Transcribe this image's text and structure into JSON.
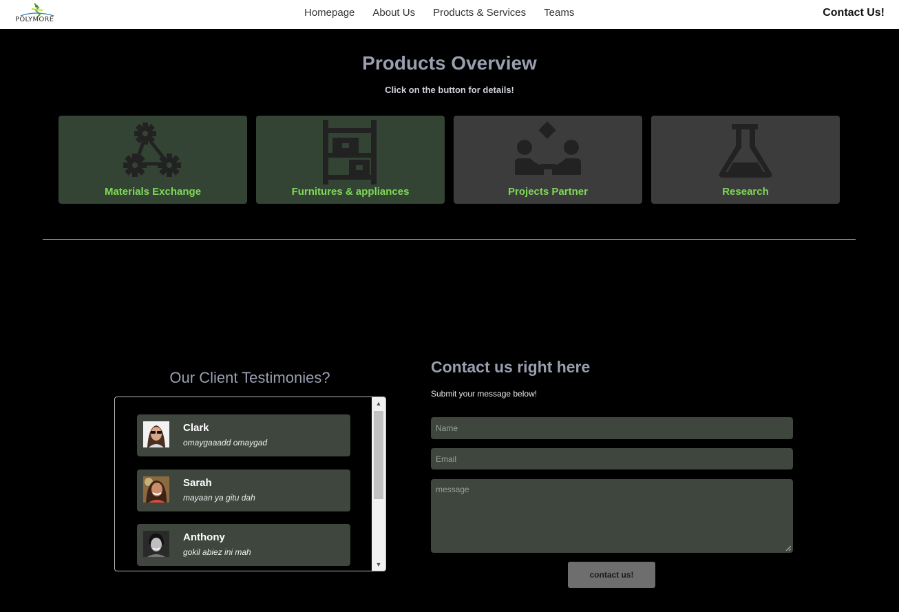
{
  "nav": {
    "logo_text": "POLYMORE",
    "links": [
      "Homepage",
      "About Us",
      "Products & Services",
      "Teams"
    ],
    "contact": "Contact Us!"
  },
  "products": {
    "title": "Products Overview",
    "subtitle": "Click on the button for details!",
    "cards": [
      {
        "label": "Materials Exchange",
        "icon": "gears-network-icon"
      },
      {
        "label": "Furnitures & appliances",
        "icon": "shelf-icon"
      },
      {
        "label": "Projects Partner",
        "icon": "handshake-icon"
      },
      {
        "label": "Research",
        "icon": "flask-icon"
      }
    ]
  },
  "testimonies": {
    "title": "Our Client Testimonies?",
    "items": [
      {
        "name": "Clark",
        "quote": "omaygaaadd omaygad"
      },
      {
        "name": "Sarah",
        "quote": "mayaan ya gitu dah"
      },
      {
        "name": "Anthony",
        "quote": "gokil abiez ini mah"
      }
    ]
  },
  "contact": {
    "title": "Contact us right here",
    "subtitle": "Submit your message below!",
    "name_placeholder": "Name",
    "email_placeholder": "Email",
    "message_placeholder": "message",
    "submit_label": "contact us!"
  },
  "colors": {
    "accent_green": "#7ed957",
    "card_green": "#344434",
    "card_gray": "#3c3c3c",
    "field_bg": "#3e463e",
    "title_gray": "#9a9fb0"
  }
}
